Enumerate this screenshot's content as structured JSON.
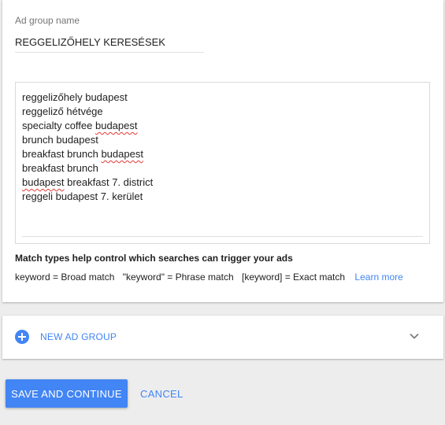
{
  "ad_group": {
    "name_label": "Ad group name",
    "name_value": "REGGELIZŐHELY KERESÉSEK",
    "keywords": [
      {
        "text": "reggelizőhely budapest",
        "parts": [
          {
            "t": "reggelizőhely budapest",
            "spell": false
          }
        ]
      },
      {
        "text": "reggeliző hétvége",
        "parts": [
          {
            "t": "reggeliző hétvége",
            "spell": false
          }
        ]
      },
      {
        "text": "specialty coffee budapest",
        "parts": [
          {
            "t": "specialty coffee ",
            "spell": false
          },
          {
            "t": "budapest",
            "spell": true
          }
        ]
      },
      {
        "text": "brunch budapest",
        "parts": [
          {
            "t": "brunch budapest",
            "spell": false
          }
        ]
      },
      {
        "text": "breakfast brunch budapest",
        "parts": [
          {
            "t": "breakfast brunch ",
            "spell": false
          },
          {
            "t": "budapest",
            "spell": true
          }
        ]
      },
      {
        "text": "breakfast brunch",
        "parts": [
          {
            "t": "breakfast brunch",
            "spell": false
          }
        ]
      },
      {
        "text": "budapest breakfast 7. district",
        "parts": [
          {
            "t": "budapest",
            "spell": true
          },
          {
            "t": " breakfast 7. district",
            "spell": false
          }
        ]
      },
      {
        "text": "reggeli budapest 7. kerület",
        "parts": [
          {
            "t": "reggeli budapest 7. kerület",
            "spell": false
          }
        ]
      }
    ],
    "match_types": {
      "heading": "Match types help control which searches can trigger your ads",
      "broad": "keyword = Broad match",
      "phrase": "\"keyword\" = Phrase match",
      "exact": "[keyword] = Exact match",
      "learn_more": "Learn more"
    }
  },
  "new_ad_group": {
    "label": "NEW AD GROUP",
    "icon": "add-circle-icon",
    "expand_icon": "chevron-down-icon"
  },
  "actions": {
    "save_label": "SAVE AND CONTINUE",
    "cancel_label": "CANCEL"
  },
  "colors": {
    "accent": "#4285f4",
    "spell_underline": "#e53935"
  }
}
